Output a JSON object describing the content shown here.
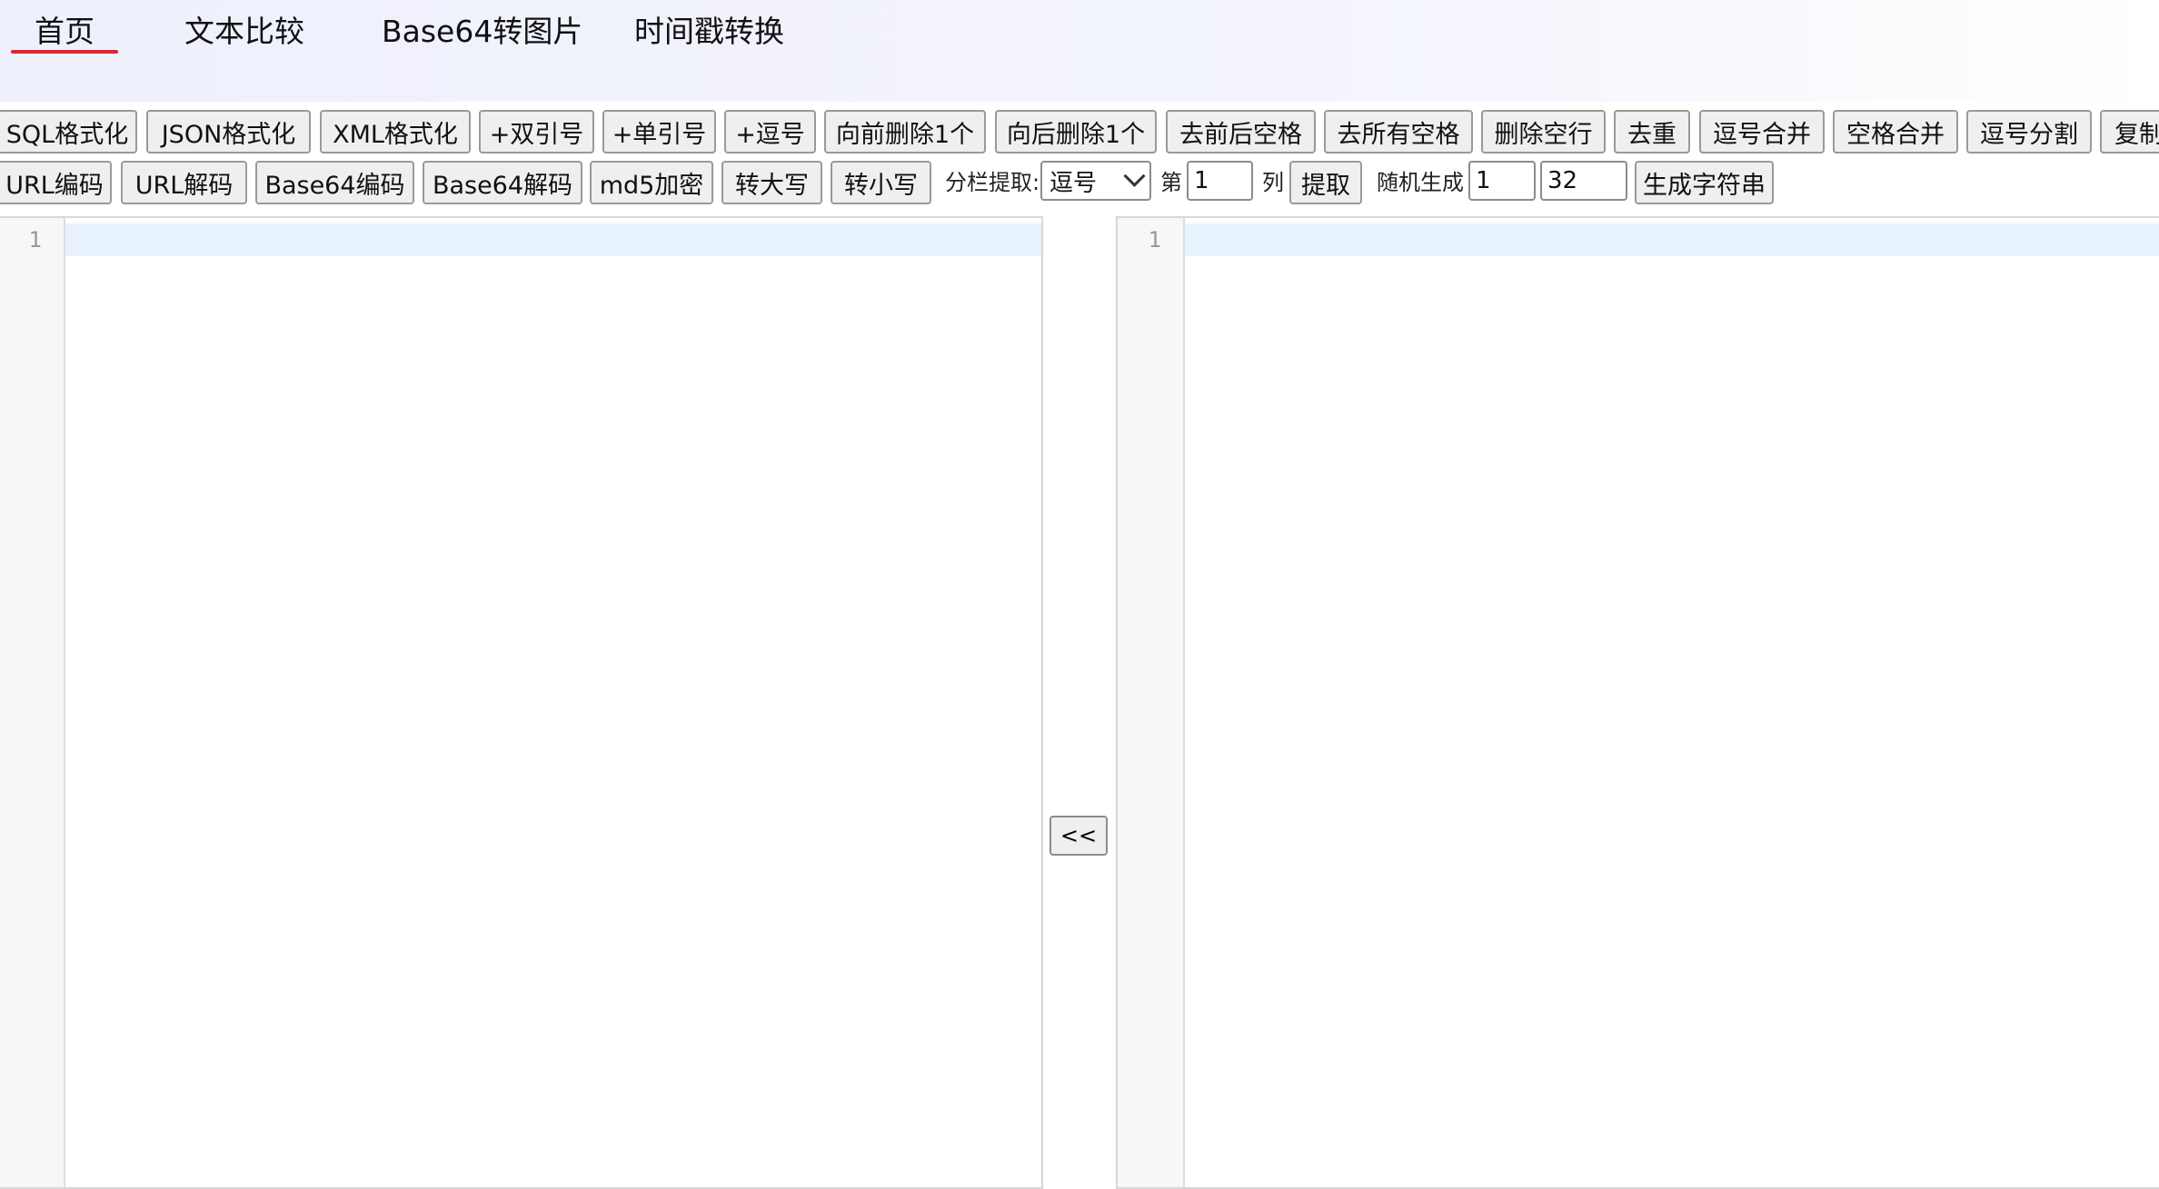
{
  "nav": {
    "items": [
      {
        "label": "首页",
        "active": true
      },
      {
        "label": "文本比较",
        "active": false
      },
      {
        "label": "Base64转图片",
        "active": false
      },
      {
        "label": "时间戳转换",
        "active": false
      }
    ],
    "accent_color": "#e0262c"
  },
  "toolbar1": {
    "buttons": [
      "SQL格式化",
      "JSON格式化",
      "XML格式化",
      "+双引号",
      "+单引号",
      "+逗号",
      "向前删除1个",
      "向后删除1个",
      "去前后空格",
      "去所有空格",
      "删除空行",
      "去重",
      "逗号合并",
      "空格合并",
      "逗号分割",
      "复制"
    ]
  },
  "toolbar2": {
    "buttons": [
      "URL编码",
      "URL解码",
      "Base64编码",
      "Base64解码",
      "md5加密",
      "转大写",
      "转小写"
    ],
    "split_label": "分栏提取:",
    "split_select_value": "逗号",
    "col_prefix": "第",
    "col_value": "1",
    "col_suffix": "列",
    "extract_button": "提取",
    "random_label": "随机生成",
    "random_count": "1",
    "random_length": "32",
    "generate_button": "生成字符串"
  },
  "editors": {
    "left": {
      "line_number": "1"
    },
    "right": {
      "line_number": "1"
    }
  },
  "transfer_button": "<<"
}
